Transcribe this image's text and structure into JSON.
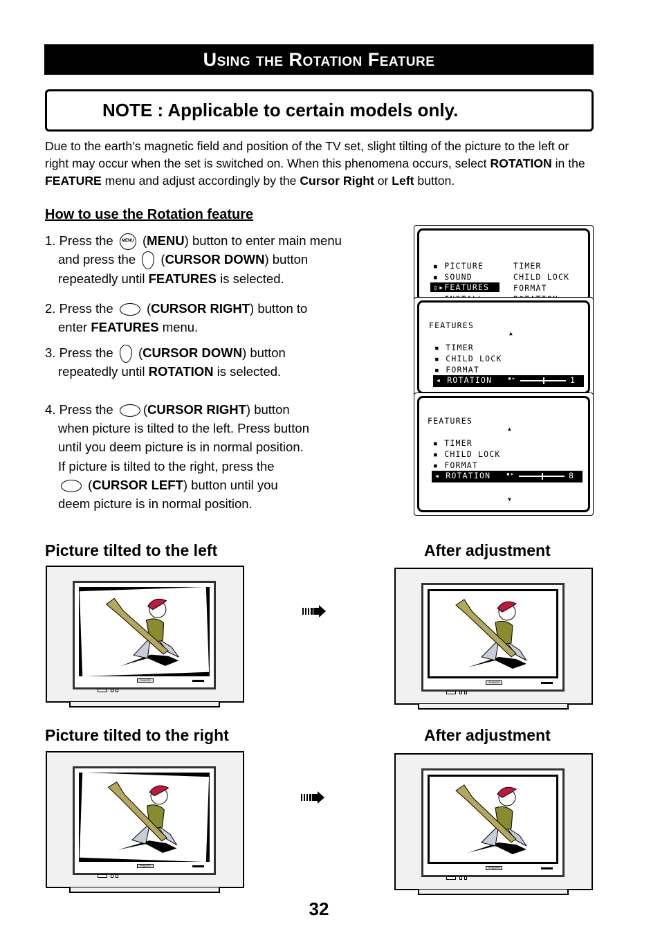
{
  "title": "Using the Rotation Feature",
  "note": "NOTE : Applicable to certain models only.",
  "intro": [
    [
      {
        "t": "Due to the earth’s magnetic field and position of the TV set, slight tilting of the picture to the left or right may occur when the set is switched on. When this phenomena occurs, select "
      },
      {
        "t": "ROTATION",
        "b": 1
      },
      {
        "t": " in the "
      },
      {
        "t": "FEATURE",
        "b": 1
      },
      {
        "t": " menu and adjust accordingly by the "
      },
      {
        "t": "Cursor Right",
        "b": 1
      },
      {
        "t": " or "
      },
      {
        "t": "Left",
        "b": 1
      },
      {
        "t": " button."
      }
    ]
  ],
  "howto_heading": "How to use the Rotation feature",
  "steps": [
    [
      {
        "t": "1. Press the "
      },
      {
        "icon": "round",
        "label": "MENU"
      },
      {
        "t": " ("
      },
      {
        "t": "MENU",
        "b": 1
      },
      {
        "t": ") button to enter main menu"
      }
    ],
    [
      {
        "t": "and press the "
      },
      {
        "icon": "vert"
      },
      {
        "t": " ("
      },
      {
        "t": "CURSOR DOWN",
        "b": 1
      },
      {
        "t": ") button"
      }
    ],
    [
      {
        "t": "repeatedly until "
      },
      {
        "t": "FEATURES",
        "b": 1
      },
      {
        "t": " is selected."
      }
    ],
    [
      {
        "t": "2. Press the "
      },
      {
        "icon": "horiz"
      },
      {
        "t": " ("
      },
      {
        "t": "CURSOR RIGHT",
        "b": 1
      },
      {
        "t": ") button to"
      }
    ],
    [
      {
        "t": "enter "
      },
      {
        "t": "FEATURES",
        "b": 1
      },
      {
        "t": " menu."
      }
    ],
    [
      {
        "t": "3. Press the "
      },
      {
        "icon": "vert"
      },
      {
        "t": " ("
      },
      {
        "t": "CURSOR DOWN",
        "b": 1
      },
      {
        "t": ") button"
      }
    ],
    [
      {
        "t": "repeatedly until "
      },
      {
        "t": "ROTATION",
        "b": 1
      },
      {
        "t": " is selected."
      }
    ],
    [
      {
        "t": "4. Press the "
      },
      {
        "icon": "horiz"
      },
      {
        "t": "("
      },
      {
        "t": "CURSOR RIGHT",
        "b": 1
      },
      {
        "t": ") button"
      }
    ],
    [
      {
        "t": "when picture is tilted to the left. Press button"
      }
    ],
    [
      {
        "t": "until you deem picture is in normal position."
      }
    ],
    [
      {
        "t": "If picture is tilted to the right, press the"
      }
    ],
    [
      {
        "icon": "horiz"
      },
      {
        "t": " ("
      },
      {
        "t": "CURSOR LEFT",
        "b": 1
      },
      {
        "t": ") button until you"
      }
    ],
    [
      {
        "t": "deem picture is in normal position."
      }
    ]
  ],
  "main_menu": {
    "left": [
      "PICTURE",
      "SOUND",
      "FEATURES",
      "INSTALL"
    ],
    "right": [
      "TIMER",
      "CHILD LOCK",
      "FORMAT",
      "ROTATION"
    ],
    "selected": "FEATURES"
  },
  "features_menus": [
    {
      "title": "FEATURES",
      "items": [
        "TIMER",
        "CHILD LOCK",
        "FORMAT"
      ],
      "selected": "ROTATION",
      "value": "1",
      "slider_fraction": 0.5
    },
    {
      "title": "FEATURES",
      "items": [
        "TIMER",
        "CHILD LOCK",
        "FORMAT"
      ],
      "selected": "ROTATION",
      "value": "8",
      "slider_fraction": 0.5
    }
  ],
  "sections": {
    "tilt_left": "Picture tilted to the left",
    "tilt_right": "Picture tilted to the right",
    "after1": "After adjustment",
    "after2": "After adjustment"
  },
  "tv_brand": "PHILIPS",
  "page_number": "32"
}
